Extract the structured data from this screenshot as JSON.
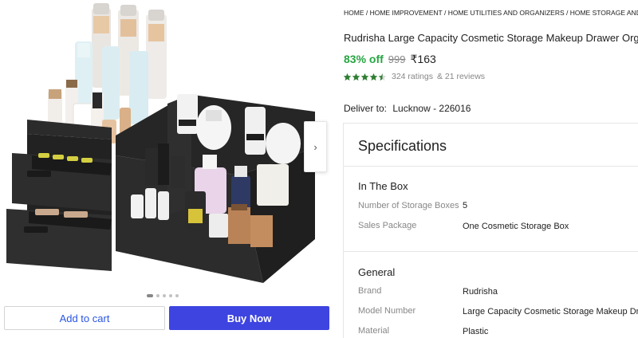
{
  "breadcrumb": [
    "HOME",
    "HOME IMPROVEMENT",
    "HOME UTILITIES AND ORGANIZERS",
    "HOME STORAGE AND ORGANIZATI"
  ],
  "product": {
    "title": "Rudrisha Large Capacity Cosmetic Storage Makeup Drawer Organi",
    "discount": "83% off",
    "mrp": "999",
    "price": "₹163",
    "rating_value": 4.5,
    "ratings_text": "324 ratings",
    "reviews_text": "& 21 reviews"
  },
  "delivery": {
    "label": "Deliver to:",
    "location": "Lucknow - 226016"
  },
  "gallery": {
    "image_count": 5,
    "active_index": 0
  },
  "actions": {
    "add_to_cart": "Add to cart",
    "buy_now": "Buy Now"
  },
  "specifications": {
    "heading": "Specifications",
    "groups": [
      {
        "title": "In The Box",
        "rows": [
          {
            "label": "Number of Storage Boxes",
            "value": "5"
          },
          {
            "label": "Sales Package",
            "value": "One Cosmetic Storage Box"
          }
        ]
      },
      {
        "title": "General",
        "rows": [
          {
            "label": "Brand",
            "value": "Rudrisha"
          },
          {
            "label": "Model Number",
            "value": "Large Capacity Cosmetic Storage Makeup Drawer"
          },
          {
            "label": "Material",
            "value": "Plastic"
          }
        ]
      }
    ]
  },
  "colors": {
    "discount_green": "#26a541",
    "star_green": "#2e7d32",
    "buy_button": "#3e44e0",
    "cart_text": "#2a55e5"
  },
  "icons": {
    "next": "chevron-right-icon",
    "star": "star-icon"
  }
}
